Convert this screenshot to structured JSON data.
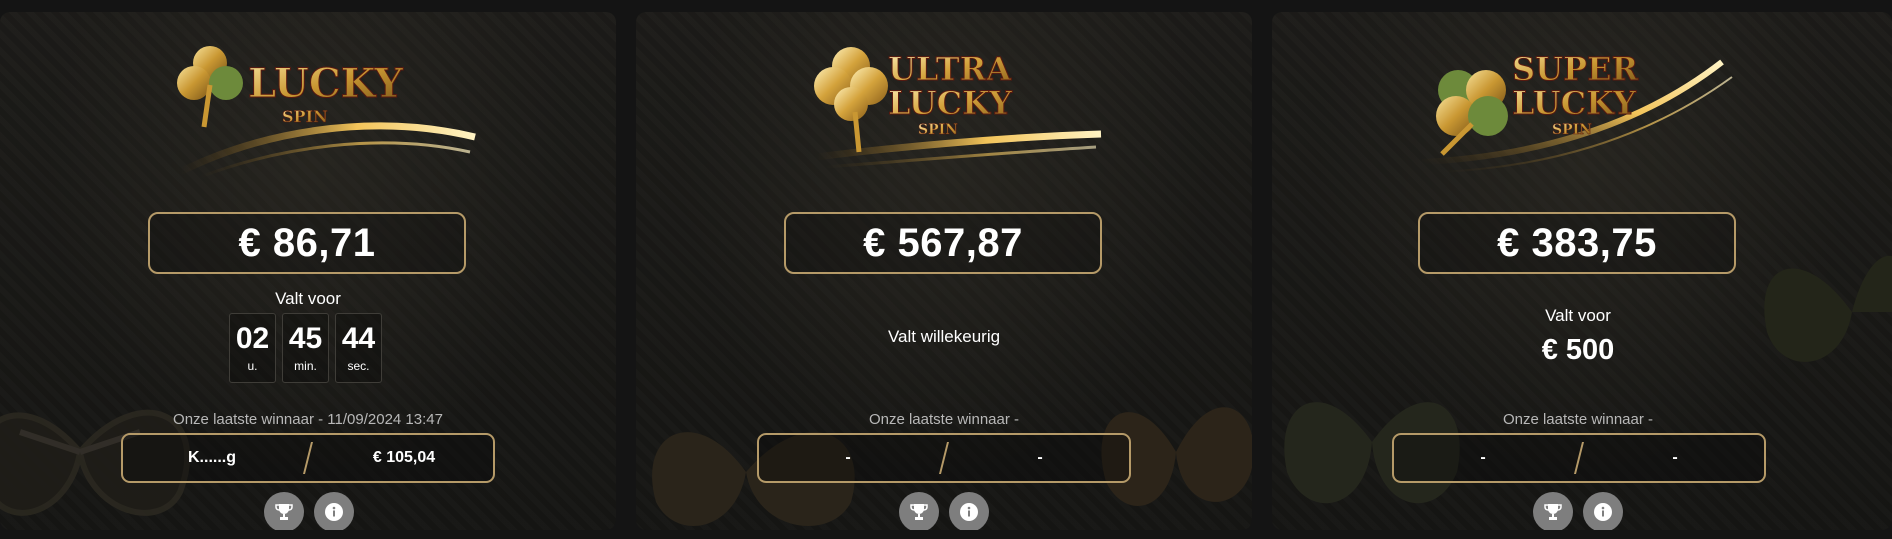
{
  "cards": [
    {
      "logo": {
        "line1": "LUCKY",
        "line2": "SPIN"
      },
      "amount": "€ 86,71",
      "falls_label": "Valt voor",
      "timer": [
        {
          "value": "02",
          "unit": "u."
        },
        {
          "value": "45",
          "unit": "min."
        },
        {
          "value": "44",
          "unit": "sec."
        }
      ],
      "winner_title": "Onze laatste winnaar - 11/09/2024 13:47",
      "winner_name": "K......g",
      "winner_amount": "€ 105,04",
      "icons": [
        "trophy-icon",
        "info-icon"
      ]
    },
    {
      "logo": {
        "line1": "ULTRA",
        "line2": "LUCKY",
        "line3": "SPIN"
      },
      "amount": "€ 567,87",
      "falls_label": "Valt willekeurig",
      "winner_title": "Onze laatste winnaar -",
      "winner_name": "-",
      "winner_amount": "-",
      "icons": [
        "trophy-icon",
        "info-icon"
      ]
    },
    {
      "logo": {
        "line1": "SUPER",
        "line2": "LUCKY",
        "line3": "SPIN"
      },
      "amount": "€ 383,75",
      "falls_label": "Valt voor",
      "falls_value": "€ 500",
      "winner_title": "Onze laatste winnaar -",
      "winner_name": "-",
      "winner_amount": "-",
      "icons": [
        "trophy-icon",
        "info-icon"
      ]
    }
  ],
  "colors": {
    "accent_gold": "#b59a68",
    "card_bg": "#1a1917",
    "icon_button": "#7e7e7e"
  }
}
